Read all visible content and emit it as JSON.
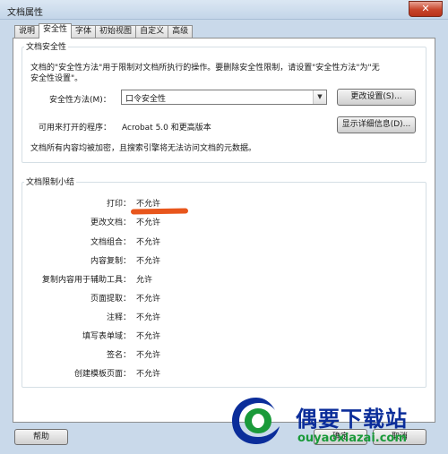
{
  "window": {
    "title": "文档属性",
    "close_glyph": "✕"
  },
  "tabs": [
    {
      "label": "说明",
      "active": false
    },
    {
      "label": "安全性",
      "active": true
    },
    {
      "label": "字体",
      "active": false
    },
    {
      "label": "初始视图",
      "active": false
    },
    {
      "label": "自定义",
      "active": false
    },
    {
      "label": "高级",
      "active": false
    }
  ],
  "security": {
    "group_title": "文档安全性",
    "desc_line1": "文档的\"安全性方法\"用于限制对文档所执行的操作。要删除安全性限制，请设置\"安全性方法\"为\"无",
    "desc_line2": "安全性设置\"。",
    "method_label": "安全性方法(M)：",
    "method_value": "口令安全性",
    "change_button": "更改设置(S)...",
    "compat_label": "可用来打开的程序：",
    "compat_value": "Acrobat 5.0 和更高版本",
    "details_button": "显示详细信息(D)...",
    "encrypted_note": "文档所有内容均被加密，且搜索引擎将无法访问文档的元数据。"
  },
  "summary": {
    "group_title": "文档限制小结",
    "rows": [
      {
        "label": "打印：",
        "value": "不允许"
      },
      {
        "label": "更改文档：",
        "value": "不允许"
      },
      {
        "label": "文档组合：",
        "value": "不允许"
      },
      {
        "label": "内容复制：",
        "value": "不允许"
      },
      {
        "label": "复制内容用于辅助工具：",
        "value": "允许"
      },
      {
        "label": "页面提取：",
        "value": "不允许"
      },
      {
        "label": "注释：",
        "value": "不允许"
      },
      {
        "label": "填写表单域：",
        "value": "不允许"
      },
      {
        "label": "签名：",
        "value": "不允许"
      },
      {
        "label": "创建模板页面：",
        "value": "不允许"
      }
    ]
  },
  "footer": {
    "help": "帮助",
    "ok": "确定",
    "cancel": "取消"
  },
  "watermark": {
    "name": "偶要下载站",
    "url": "ouyaoxiazai.com"
  },
  "colors": {
    "highlight_mark": "#e8561c",
    "watermark_blue": "#0b2d9a",
    "watermark_green": "#1a9a3a"
  }
}
